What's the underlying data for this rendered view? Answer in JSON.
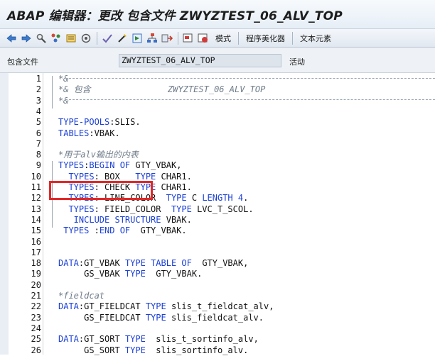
{
  "window": {
    "title": "ABAP 编辑器：更改 包含文件 ZWYZTEST_06_ALV_TOP"
  },
  "toolbar": {
    "icons": [
      "back-arrow-icon",
      "forward-arrow-icon",
      "tools-icon",
      "object-list-icon",
      "display-object-icon",
      "where-used-icon",
      "check-icon",
      "activate-icon",
      "test-icon",
      "hierarchy-icon",
      "navigate-icon",
      "pattern-icon",
      "insert-statement-icon"
    ],
    "buttons": [
      "模式",
      "程序美化器",
      "文本元素"
    ]
  },
  "infobar": {
    "label": "包含文件",
    "value": "ZWYZTEST_06_ALV_TOP",
    "status": "活动"
  },
  "editor": {
    "lines": [
      {
        "num": "1",
        "tokens": [
          {
            "t": "*&",
            "c": "cm"
          }
        ]
      },
      {
        "num": "2",
        "tokens": [
          {
            "t": "*& 包含               ZWYZTEST_06_ALV_TOP",
            "c": "cm"
          }
        ]
      },
      {
        "num": "3",
        "tokens": [
          {
            "t": "*&",
            "c": "cm"
          }
        ]
      },
      {
        "num": "4",
        "tokens": []
      },
      {
        "num": "5",
        "tokens": [
          {
            "t": "TYPE-POOLS",
            "c": "kw"
          },
          {
            "t": ":SLIS.",
            "c": "id"
          }
        ]
      },
      {
        "num": "6",
        "tokens": [
          {
            "t": "TABLES",
            "c": "kw"
          },
          {
            "t": ":VBAK.",
            "c": "id"
          }
        ]
      },
      {
        "num": "7",
        "tokens": []
      },
      {
        "num": "8",
        "tokens": [
          {
            "t": "*用于alv输出的内表",
            "c": "cm"
          }
        ]
      },
      {
        "num": "9",
        "tokens": [
          {
            "t": "TYPES",
            "c": "kw"
          },
          {
            "t": ":",
            "c": "id"
          },
          {
            "t": "BEGIN OF ",
            "c": "kw"
          },
          {
            "t": "GTY_VBAK,",
            "c": "id"
          }
        ]
      },
      {
        "num": "10",
        "tokens": [
          {
            "t": "  TYPES",
            "c": "kw"
          },
          {
            "t": ": BOX   ",
            "c": "id"
          },
          {
            "t": "TYPE ",
            "c": "kw"
          },
          {
            "t": "CHAR1.",
            "c": "id"
          }
        ]
      },
      {
        "num": "11",
        "tokens": [
          {
            "t": "  TYPES",
            "c": "kw"
          },
          {
            "t": ": CHECK ",
            "c": "id"
          },
          {
            "t": "TYPE ",
            "c": "kw"
          },
          {
            "t": "CHAR1.",
            "c": "id"
          }
        ]
      },
      {
        "num": "12",
        "tokens": [
          {
            "t": "  TYPES",
            "c": "kw"
          },
          {
            "t": ": LINE_COLOR  ",
            "c": "id"
          },
          {
            "t": "TYPE ",
            "c": "kw"
          },
          {
            "t": "C ",
            "c": "id"
          },
          {
            "t": "LENGTH ",
            "c": "kw"
          },
          {
            "t": "4",
            "c": "num"
          },
          {
            "t": ".",
            "c": "id"
          }
        ]
      },
      {
        "num": "13",
        "tokens": [
          {
            "t": "  TYPES",
            "c": "kw"
          },
          {
            "t": ": FIELD_COLOR  ",
            "c": "id"
          },
          {
            "t": "TYPE ",
            "c": "kw"
          },
          {
            "t": "LVC_T_SCOL.",
            "c": "id"
          }
        ]
      },
      {
        "num": "14",
        "tokens": [
          {
            "t": "   INCLUDE STRUCTURE ",
            "c": "kw"
          },
          {
            "t": "VBAK.",
            "c": "id"
          }
        ]
      },
      {
        "num": "15",
        "tokens": [
          {
            "t": " TYPES ",
            "c": "kw"
          },
          {
            "t": ":",
            "c": "id"
          },
          {
            "t": "END OF  ",
            "c": "kw"
          },
          {
            "t": "GTY_VBAK.",
            "c": "id"
          }
        ]
      },
      {
        "num": "16",
        "tokens": []
      },
      {
        "num": "17",
        "tokens": []
      },
      {
        "num": "18",
        "tokens": [
          {
            "t": "DATA",
            "c": "kw"
          },
          {
            "t": ":GT_VBAK ",
            "c": "id"
          },
          {
            "t": "TYPE TABLE OF  ",
            "c": "kw"
          },
          {
            "t": "GTY_VBAK,",
            "c": "id"
          }
        ]
      },
      {
        "num": "19",
        "tokens": [
          {
            "t": "     GS_VBAK ",
            "c": "id"
          },
          {
            "t": "TYPE  ",
            "c": "kw"
          },
          {
            "t": "GTY_VBAK.",
            "c": "id"
          }
        ]
      },
      {
        "num": "20",
        "tokens": []
      },
      {
        "num": "21",
        "tokens": [
          {
            "t": "*fieldcat",
            "c": "cm"
          }
        ]
      },
      {
        "num": "22",
        "tokens": [
          {
            "t": "DATA",
            "c": "kw"
          },
          {
            "t": ":GT_FIELDCAT ",
            "c": "id"
          },
          {
            "t": "TYPE ",
            "c": "kw"
          },
          {
            "t": "slis_t_fieldcat_alv,",
            "c": "id"
          }
        ]
      },
      {
        "num": "23",
        "tokens": [
          {
            "t": "     GS_FIELDCAT ",
            "c": "id"
          },
          {
            "t": "TYPE ",
            "c": "kw"
          },
          {
            "t": "slis_fieldcat_alv.",
            "c": "id"
          }
        ]
      },
      {
        "num": "24",
        "tokens": []
      },
      {
        "num": "25",
        "tokens": [
          {
            "t": "DATA",
            "c": "kw"
          },
          {
            "t": ":GT_SORT ",
            "c": "id"
          },
          {
            "t": "TYPE  ",
            "c": "kw"
          },
          {
            "t": "slis_t_sortinfo_alv,",
            "c": "id"
          }
        ]
      },
      {
        "num": "26",
        "tokens": [
          {
            "t": "     GS_SORT ",
            "c": "id"
          },
          {
            "t": "TYPE  ",
            "c": "kw"
          },
          {
            "t": "slis_sortinfo_alv.",
            "c": "id"
          }
        ]
      }
    ]
  },
  "colors": {
    "keyword": "#1a3fd6",
    "comment": "#6f7c8a",
    "highlight": "#e22727"
  }
}
